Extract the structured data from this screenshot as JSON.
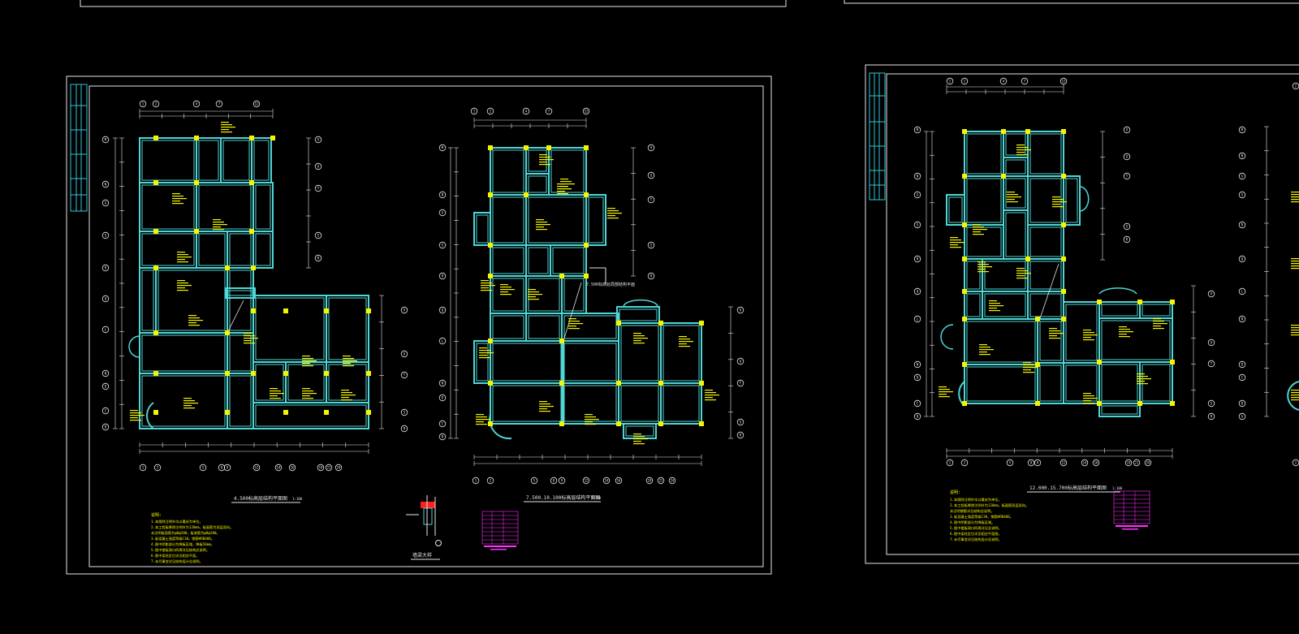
{
  "app": {
    "background": "#000000"
  },
  "colors": {
    "frame": "#e6e6e6",
    "wall": "#4fd6d6",
    "column": "#f5f500",
    "dim": "#e6e6e6",
    "note": "#f5f500",
    "table": "#ff33ff",
    "titleblock": "#2ec8d8"
  },
  "sheet1": {
    "plan_a_title": "4.500标高层结构平面图",
    "plan_a_scale": "1:100",
    "plan_b_title": "7.500.10.100标高层结构平面图",
    "plan_b_scale": "1:100",
    "plan_b_callout": "7.500标高处局部结构平面",
    "detail_title": "墙梁大样",
    "notes_heading": "说明:",
    "notes": [
      "1.本图除注明外均以毫米为单位。",
      "2.本工程板厚除注明外为120mm，板面筋为双层双向。",
      "  未注明板面筋为φ8@200，板底筋为φ8@200。",
      "3.板混凝土强度等级C30，钢筋HRB400。",
      "4.图中阴影部分为降板区域，降板50mm。",
      "5.图中楼板洞口四周详见结构总说明。",
      "6.图中梁柱定位详见相应平面。",
      "7.未尽事宜详见结构设计总说明。"
    ]
  },
  "sheet2": {
    "plan_title": "12.000.15.700标高层结构平面图",
    "plan_scale": "1:100",
    "notes_heading": "说明:",
    "notes": [
      "1.本图除注明外均以毫米为单位。",
      "2.本工程板厚除注明外为120mm，板面筋双层双向。",
      "  未注明钢筋详见结构总说明。",
      "3.板混凝土强度等级C30，钢筋HRB400。",
      "4.图中阴影部分为降板区域。",
      "5.图中楼板洞口四周详见总说明。",
      "6.图中梁柱定位详见相应平面图。",
      "7.未尽事宜详见结构设计总说明。"
    ]
  },
  "axes": {
    "bottom_a": [
      "1",
      "2",
      "5",
      "8",
      "9",
      "12",
      "14",
      "16",
      "19",
      "21",
      "24"
    ],
    "top_a": [
      "1",
      "2",
      "4",
      "7",
      "12"
    ],
    "left_a": [
      "M",
      "N",
      "G",
      "S",
      "R",
      "Q",
      "L",
      "N",
      "D",
      "C",
      "B",
      "A"
    ],
    "right_a": [
      "V",
      "U",
      "T",
      "S",
      "R"
    ],
    "bottom_b": [
      "1",
      "2",
      "5",
      "8",
      "9",
      "12",
      "14",
      "16",
      "19",
      "21",
      "24"
    ],
    "top_b": [
      "1",
      "2",
      "4",
      "7",
      "12"
    ],
    "bottom_c": [
      "1",
      "2",
      "5",
      "8",
      "9",
      "12",
      "14",
      "16",
      "19",
      "21",
      "24"
    ],
    "top_c": [
      "1",
      "2",
      "4",
      "7",
      "12"
    ]
  }
}
